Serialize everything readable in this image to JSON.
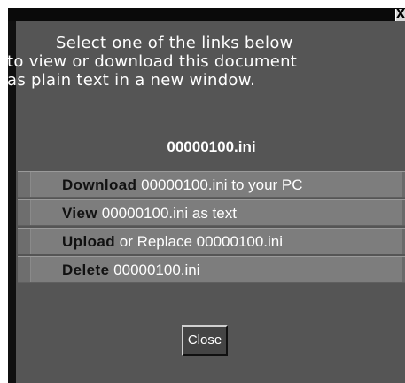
{
  "dialog": {
    "close_x_label": "X",
    "intro_lines": [
      "Select one of the links below",
      "to view or download this document",
      "as plain text in a new window."
    ],
    "document_name": "00000100.ini",
    "menu": [
      {
        "action": "Download",
        "rest": " 00000100.ini to your PC"
      },
      {
        "action": "View",
        "rest": " 00000100.ini as text"
      },
      {
        "action": "Upload",
        "rest": " or Replace 00000100.ini"
      },
      {
        "action": "Delete",
        "rest": " 00000100.ini"
      }
    ],
    "close_button_label": "Close"
  },
  "colors": {
    "dialog_background": "#555555",
    "menu_row": "#7d7d7d",
    "action_text": "#111111",
    "body_text": "#ffffff"
  }
}
